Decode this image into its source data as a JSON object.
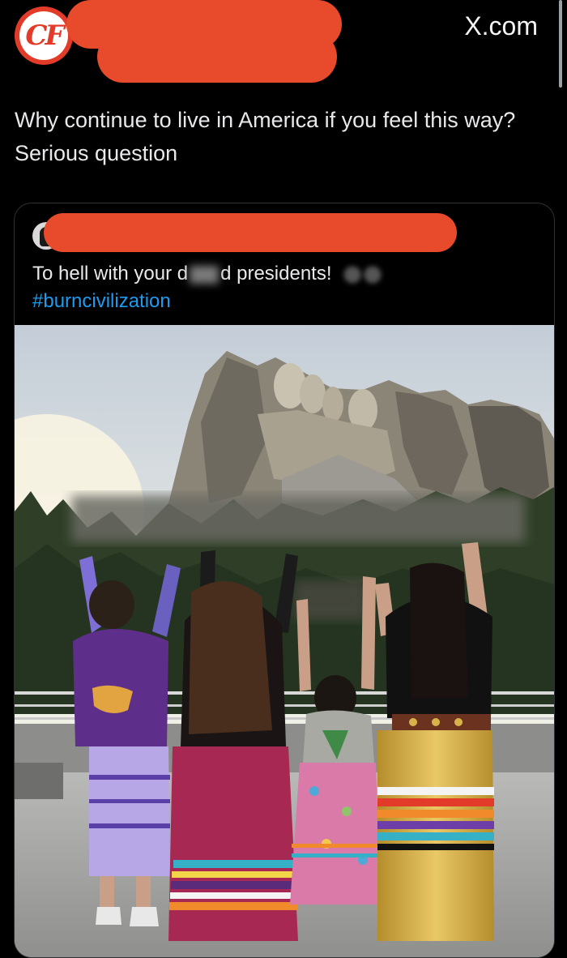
{
  "header": {
    "avatar_text": "CF",
    "site_label": "X.com"
  },
  "post": {
    "text": "Why continue to live in America if you feel this way? Serious question"
  },
  "quoted_post": {
    "text_before": "To hell with your d",
    "text_after": "d presidents!",
    "hashtag": "#burncivilization"
  },
  "colors": {
    "background": "#000000",
    "redaction": "#e74b2b",
    "hashtag": "#1d9bf0",
    "text": "#e7e9ea"
  },
  "photo": {
    "description_icon": "photo-image",
    "subject": "four people with raised arms facing a carved mountain"
  }
}
